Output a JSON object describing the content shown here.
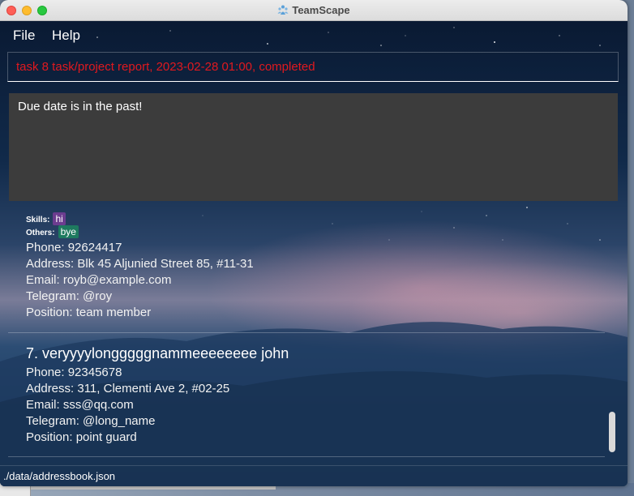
{
  "window": {
    "title": "TeamScape"
  },
  "menu": {
    "file": "File",
    "help": "Help"
  },
  "command": {
    "value": "task 8 task/project report, 2023-02-28 01:00, completed"
  },
  "result": {
    "message": "Due date is in the past!"
  },
  "list": {
    "card_partial": {
      "tag_row_1": {
        "label": "Skills:",
        "tag": "hi"
      },
      "tag_row_2": {
        "label": "Others:",
        "tag": "bye"
      },
      "phone": "Phone: 92624417",
      "address": "Address: Blk 45 Aljunied Street 85, #11-31",
      "email": "Email: royb@example.com",
      "telegram": "Telegram: @roy",
      "position": "Position: team member"
    },
    "card_7": {
      "title": "7. veryyyylongggggnammeeeeeeee john",
      "phone": "Phone: 92345678",
      "address": "Address: 311, Clementi Ave 2, #02-25",
      "email": "Email: sss@qq.com",
      "telegram": "Telegram: @long_name",
      "position": "Position: point guard"
    }
  },
  "status": {
    "path": "./data/addressbook.json"
  },
  "colors": {
    "command_text": "#e0191f",
    "result_bg": "#3c3c3c",
    "tag_purple": "#6b3c8f",
    "tag_green": "#1e7a5f"
  }
}
